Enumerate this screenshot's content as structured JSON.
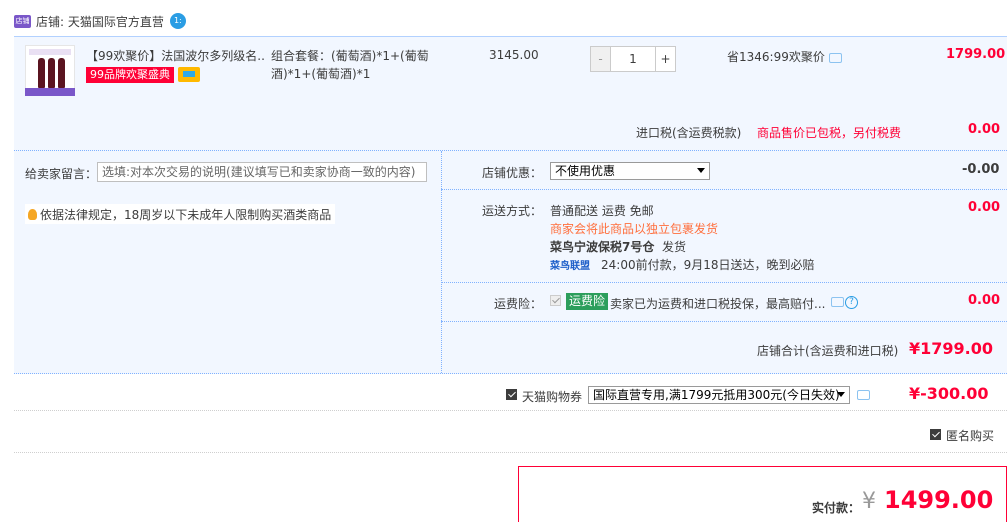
{
  "shop": {
    "badge": "店铺",
    "label": "店铺: 天猫国际官方直营",
    "ww": "1:"
  },
  "item": {
    "title": "【99欢聚价】法国波尔多列级名...",
    "tag": "99品牌欢聚盛典",
    "combo": "组合套餐：(葡萄酒)*1+(葡萄酒)*1+(葡萄酒)*1",
    "price": "3145.00",
    "qty_minus": "-",
    "qty": "1",
    "qty_plus": "+",
    "discount": "省1346:99欢聚价",
    "subtotal": "1799.00"
  },
  "tax": {
    "label": "进口税(含运费税款)",
    "note": "商品售价已包税，另付税费",
    "value": "0.00"
  },
  "memo": {
    "label": "给卖家留言：",
    "placeholder": "选填:对本次交易的说明(建议填写已和卖家协商一致的内容)"
  },
  "law_notice": "依据法律规定，18周岁以下未成年人限制购买酒类商品",
  "shop_discount": {
    "label": "店铺优惠：",
    "selected": "不使用优惠",
    "value": "-0.00"
  },
  "shipping": {
    "label": "运送方式：",
    "line1": "普通配送 运费 免邮",
    "line2": "商家会将此商品以独立包裹发货",
    "warehouse": "菜鸟宁波保税7号仓",
    "dispatch": "发货",
    "logo": "菜鸟联盟",
    "line4": "24:00前付款，9月18日送达，晚到必赔",
    "value": "0.00"
  },
  "insurance": {
    "label": "运费险：",
    "badge": "运费险",
    "text": "卖家已为运费和进口税投保，最高赔付...",
    "help": "?",
    "value": "0.00"
  },
  "shop_total": {
    "label": "店铺合计(含运费和进口税)",
    "value": "¥1799.00"
  },
  "coupon": {
    "label": "天猫购物券",
    "selected": "国际直营专用,满1799元抵用300元(今日失效)",
    "value": "¥-300.00"
  },
  "anonymous": {
    "label": "匿名购买"
  },
  "payment": {
    "label": "实付款：",
    "yen": "¥",
    "value": "1499.00"
  }
}
